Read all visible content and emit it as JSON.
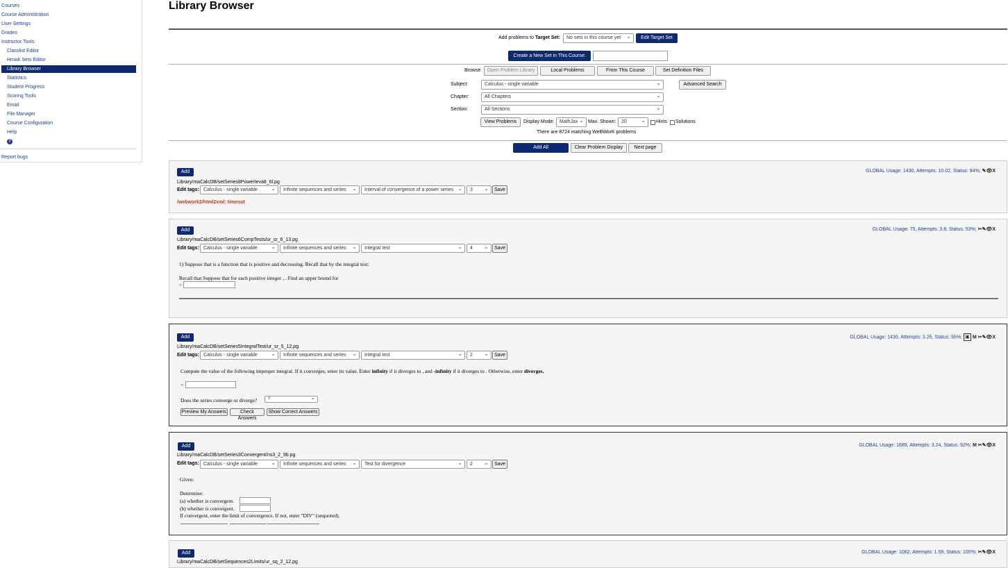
{
  "sidebar": {
    "courses": "Courses",
    "course_admin": "Course Administration",
    "user_settings": "User Settings",
    "grades": "Grades",
    "instructor_tools": "Instructor Tools",
    "classlist_editor": "Classlist Editor",
    "hmwk_sets_editor": "Hmwk Sets Editor",
    "library_browser": "Library Browser",
    "statistics": "Statistics",
    "student_progress": "Student Progress",
    "scoring_tools": "Scoring Tools",
    "email": "Email",
    "file_manager": "File Manager",
    "course_config": "Course Configuration",
    "help": "Help",
    "help_icon": "?",
    "report_bugs": "Report bugs"
  },
  "page": {
    "title": "Library Browser"
  },
  "target": {
    "label_pre": "Add problems to ",
    "label_bold": "Target Set:",
    "select_value": "No sets in this course yet",
    "edit_btn": "Edit Target Set",
    "create_btn": "Create a New Set in This Course:",
    "create_input": ""
  },
  "browse": {
    "label": "Browse",
    "open_library": "Open Problem Library",
    "local": "Local Problems",
    "from_course": "From This Course",
    "set_def": "Set Definition Files",
    "subject_label": "Subject:",
    "subject_value": "Calculus - single variable",
    "advanced": "Advanced Search",
    "chapter_label": "Chapter:",
    "chapter_value": "All Chapters",
    "section_label": "Section:",
    "section_value": "All Sections",
    "view_btn": "View Problems",
    "display_label": "Display Mode:",
    "display_value": "MathJax",
    "max_label": "Max. Shown:",
    "max_value": "20",
    "hints": "Hints",
    "solutions": "Solutions",
    "matching": "There are 8724 matching WeBWorK problems"
  },
  "actions": {
    "add_all": "Add All",
    "clear": "Clear Problem Display",
    "next": "Next page"
  },
  "common": {
    "add": "Add",
    "edit_tags": "Edit tags:",
    "save": "Save",
    "usage_label": "GLOBAL Usage:",
    "attempts_label": "Attempts:",
    "status_label": "Status:",
    "tag_subject": "Calculus - single variable",
    "tag_chapter": "Infinite sequences and series"
  },
  "problems": [
    {
      "path": "Library/maCalcDB/setSeries8PowerIeva8_6l.pg",
      "usage": "1430,",
      "attempts": "10.02,",
      "status": "94%;",
      "icons": "✎👁X",
      "section": "Interval of convergence of a power series",
      "level": "3",
      "error": "/webwork2/html2xml: timeout"
    },
    {
      "path": "Library/maCalcDB/setSeries6CompTests/ur_sr_6_13.pg",
      "usage": "75,",
      "attempts": "3.8,",
      "status": "53%;",
      "icons": "✂✎👁X",
      "section": "Integral test",
      "level": "4",
      "text1": "1) Suppose that is a function that is positive and decreasing. Recall that by the integral test:",
      "text2": "Recall that Suppose that for each positive integer , . Find an upper bound for",
      "eq": "="
    },
    {
      "path": "Library/maCalcDB/setSeries5IntegralTest/ur_sr_5_12.pg",
      "usage": "1430,",
      "attempts": "3.25,",
      "status": "95%;",
      "icons_pre": "M",
      "icons": "✂✎👁X",
      "section": "Integral test",
      "level": "2",
      "q_a": "Compute the value of the following improper integral. If it converges, enter its value. Enter ",
      "q_b": "infinity",
      "q_c": " if it diverges to , and ",
      "q_d": "-infinity",
      "q_e": " if it diverges to . Otherwise, enter ",
      "q_f": "diverges.",
      "eq": "=",
      "conv_q": "Does the series converge or diverge?",
      "conv_sel": "?",
      "preview": "Preview My Answers",
      "check": "Check Answers",
      "show": "Show Correct Answers"
    },
    {
      "path": "Library/maCalcDB/setSeries3Convergent/ns3_2_9b.pg",
      "usage": "1689,",
      "attempts": "3.24,",
      "status": "92%;",
      "icons": "M ✂✎👁X",
      "section": "Test for divergence",
      "level": "2",
      "given": "Given:",
      "determine": "Determine:",
      "a": "(a) whether is convergent.",
      "b": "(b) whether is convergent.",
      "note": "If convergent, enter the limit of convergence. If not, enter \"DIV\" (unquoted)."
    },
    {
      "path": "Library/maCalcDB/setSequences2Limits/ur_sq_2_12.pg",
      "usage": "1062,",
      "attempts": "1.59,",
      "status": "100%;",
      "icons": "✂✎👁X"
    }
  ]
}
